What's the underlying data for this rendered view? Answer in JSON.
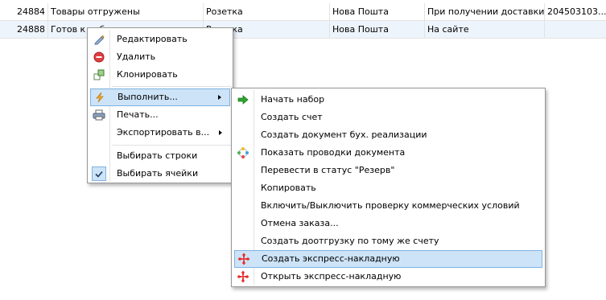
{
  "grid": {
    "rows": [
      {
        "id": "24884",
        "status": "Товары отгружены",
        "source": "Розетка",
        "shipping": "Нова Пошта",
        "payment": "При получении доставки",
        "ttn": "204503103..."
      },
      {
        "id": "24888",
        "status": "Готов к набору",
        "source": "Розетка",
        "shipping": "Нова Пошта",
        "payment": "На сайте",
        "ttn": ""
      }
    ]
  },
  "context_menu": {
    "items": [
      {
        "label": "Редактировать",
        "icon": "pencil-icon"
      },
      {
        "label": "Удалить",
        "icon": "delete-icon"
      },
      {
        "label": "Клонировать",
        "icon": "clone-icon"
      },
      {
        "label": "Выполнить...",
        "icon": "lightning-icon",
        "submenu": true,
        "highlighted": true
      },
      {
        "label": "Печать...",
        "icon": "printer-icon"
      },
      {
        "label": "Экспортировать в...",
        "icon": "",
        "submenu": true
      },
      {
        "label": "Выбирать строки",
        "icon": ""
      },
      {
        "label": "Выбирать ячейки",
        "icon": "checkmark-icon",
        "checked": true
      }
    ]
  },
  "submenu": {
    "items": [
      {
        "label": "Начать набор",
        "icon": "green-arrow-icon"
      },
      {
        "label": "Создать счет",
        "icon": ""
      },
      {
        "label": "Создать документ бух. реализации",
        "icon": ""
      },
      {
        "label": "Показать проводки документа",
        "icon": "transactions-icon"
      },
      {
        "label": "Перевести в статус \"Резерв\"",
        "icon": ""
      },
      {
        "label": "Копировать",
        "icon": ""
      },
      {
        "label": "Включить/Выключить проверку коммерческих условий",
        "icon": ""
      },
      {
        "label": "Отмена заказа...",
        "icon": ""
      },
      {
        "label": "Создать доотгрузку по тому же счету",
        "icon": ""
      },
      {
        "label": "Создать экспресс-накладную",
        "icon": "nova-poshta-icon",
        "highlighted": true
      },
      {
        "label": "Открыть экспресс-накладную",
        "icon": "nova-poshta-icon"
      }
    ]
  },
  "colors": {
    "highlight_fill": "#cde3f7",
    "highlight_border": "#7fb3e0",
    "nova_poshta_red": "#e52a2a",
    "action_green": "#2fa52f"
  }
}
